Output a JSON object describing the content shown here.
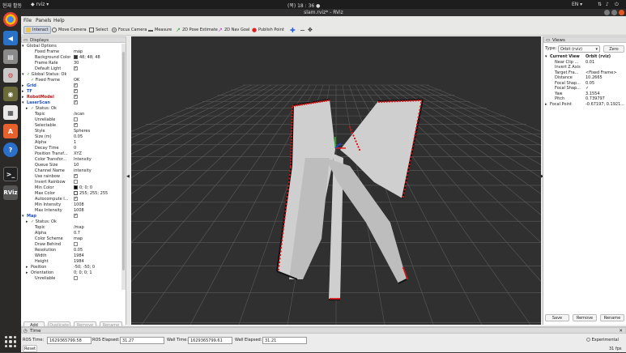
{
  "topbar": {
    "activities": "현재 활동",
    "app": "rviz",
    "clock": "(목) 18 : 36 ●",
    "lang": "EN ▾"
  },
  "window": {
    "title": "slam.rviz* - RViz"
  },
  "menu": [
    "File",
    "Panels",
    "Help"
  ],
  "toolbar": [
    {
      "label": "Interact",
      "icon": "interact-icon",
      "active": true
    },
    {
      "label": "Move Camera",
      "icon": "move-camera-icon"
    },
    {
      "label": "Select",
      "icon": "select-icon"
    },
    {
      "label": "Focus Camera",
      "icon": "focus-camera-icon"
    },
    {
      "label": "Measure",
      "icon": "measure-icon"
    },
    {
      "label": "2D Pose Estimate",
      "icon": "pose-estimate-icon"
    },
    {
      "label": "2D Nav Goal",
      "icon": "nav-goal-icon"
    },
    {
      "label": "Publish Point",
      "icon": "publish-point-icon"
    }
  ],
  "displays": {
    "title": "Displays",
    "rows": [
      {
        "k": "Global Options",
        "ind": 1,
        "exp": "▾",
        "icon": "globe"
      },
      {
        "k": "Fixed Frame",
        "v": "map",
        "ind": 3
      },
      {
        "k": "Background Color",
        "v": "48; 48; 48",
        "ind": 3,
        "sw": "#303030"
      },
      {
        "k": "Frame Rate",
        "v": "30",
        "ind": 3
      },
      {
        "k": "Default Light",
        "v": "",
        "ind": 3,
        "chk": true
      },
      {
        "k": "Global Status: Ok",
        "ind": 1,
        "exp": "▾",
        "ok": true
      },
      {
        "k": "Fixed Frame",
        "v": "OK",
        "ind": 2,
        "ok": true
      },
      {
        "k": "Grid",
        "ind": 1,
        "exp": "▸",
        "blue": true,
        "chk": true
      },
      {
        "k": "TF",
        "ind": 1,
        "exp": "▸",
        "blue": true,
        "chk": true
      },
      {
        "k": "RobotModel",
        "ind": 1,
        "exp": "▸",
        "red": true,
        "chk": true
      },
      {
        "k": "LaserScan",
        "ind": 1,
        "exp": "▾",
        "blue": true,
        "chk": true
      },
      {
        "k": "Status: Ok",
        "ind": 2,
        "exp": "▸",
        "ok": true
      },
      {
        "k": "Topic",
        "v": "/scan",
        "ind": 3
      },
      {
        "k": "Unreliable",
        "v": "",
        "ind": 3,
        "chk": false
      },
      {
        "k": "Selectable",
        "v": "",
        "ind": 3,
        "chk": true
      },
      {
        "k": "Style",
        "v": "Spheres",
        "ind": 3
      },
      {
        "k": "Size (m)",
        "v": "0.05",
        "ind": 3
      },
      {
        "k": "Alpha",
        "v": "1",
        "ind": 3
      },
      {
        "k": "Decay Time",
        "v": "0",
        "ind": 3
      },
      {
        "k": "Position Transf...",
        "v": "XYZ",
        "ind": 3
      },
      {
        "k": "Color Transfor...",
        "v": "Intensity",
        "ind": 3
      },
      {
        "k": "Queue Size",
        "v": "10",
        "ind": 3
      },
      {
        "k": "Channel Name",
        "v": "intensity",
        "ind": 3
      },
      {
        "k": "Use rainbow",
        "v": "",
        "ind": 3,
        "chk": true
      },
      {
        "k": "Invert Rainbow",
        "v": "",
        "ind": 3,
        "chk": false
      },
      {
        "k": "Min Color",
        "v": "0; 0; 0",
        "ind": 3,
        "sw": "#000000"
      },
      {
        "k": "Max Color",
        "v": "255; 255; 255",
        "ind": 3,
        "sw": "#ffffff"
      },
      {
        "k": "Autocompute I...",
        "v": "",
        "ind": 3,
        "chk": true
      },
      {
        "k": "Min Intensity",
        "v": "1008",
        "ind": 3
      },
      {
        "k": "Max Intensity",
        "v": "1008",
        "ind": 3
      },
      {
        "k": "Map",
        "ind": 1,
        "exp": "▾",
        "blue": true,
        "chk": true
      },
      {
        "k": "Status: Ok",
        "ind": 2,
        "exp": "▸",
        "ok": true
      },
      {
        "k": "Topic",
        "v": "/map",
        "ind": 3
      },
      {
        "k": "Alpha",
        "v": "0.7",
        "ind": 3
      },
      {
        "k": "Color Scheme",
        "v": "map",
        "ind": 3
      },
      {
        "k": "Draw Behind",
        "v": "",
        "ind": 3,
        "chk": false
      },
      {
        "k": "Resolution",
        "v": "0.05",
        "ind": 3
      },
      {
        "k": "Width",
        "v": "1984",
        "ind": 3
      },
      {
        "k": "Height",
        "v": "1984",
        "ind": 3
      },
      {
        "k": "Position",
        "v": "-50; -50; 0",
        "ind": 2,
        "exp": "▸"
      },
      {
        "k": "Orientation",
        "v": "0; 0; 0; 1",
        "ind": 2,
        "exp": "▸"
      },
      {
        "k": "Unreliable",
        "v": "",
        "ind": 3,
        "chk": false
      }
    ],
    "buttons": {
      "add": "Add",
      "duplicate": "Duplicate",
      "remove": "Remove",
      "rename": "Rename"
    }
  },
  "views": {
    "title": "Views",
    "type_label": "Type:",
    "type_value": "Orbit (rviz)",
    "zero": "Zero",
    "rows": [
      {
        "k": "Current View",
        "v": "Orbit (rviz)",
        "bold": true,
        "ind": 1,
        "exp": "▾"
      },
      {
        "k": "Near Clip ...",
        "v": "0.01",
        "ind": 2
      },
      {
        "k": "Invert Z Axis",
        "v": "",
        "ind": 2
      },
      {
        "k": "Target Fra...",
        "v": "<Fixed Frame>",
        "ind": 2
      },
      {
        "k": "Distance",
        "v": "10.2665",
        "ind": 2
      },
      {
        "k": "Focal Shap...",
        "v": "0.05",
        "ind": 2
      },
      {
        "k": "Focal Shap...",
        "v": "✓",
        "ind": 2
      },
      {
        "k": "Yaw",
        "v": "3.1554",
        "ind": 2
      },
      {
        "k": "Pitch",
        "v": "0.739797",
        "ind": 2
      },
      {
        "k": "Focal Point",
        "v": "-0.67197; 0.1921...",
        "ind": 1,
        "exp": "▸"
      }
    ],
    "buttons": {
      "save": "Save",
      "remove": "Remove",
      "rename": "Rename"
    }
  },
  "time": {
    "title": "Time",
    "ros_time_label": "ROS Time:",
    "ros_time": "1629365799.58",
    "ros_elapsed_label": "ROS Elapsed:",
    "ros_elapsed": "31.27",
    "wall_time_label": "Wall Time:",
    "wall_time": "1629365799.61",
    "wall_elapsed_label": "Wall Elapsed:",
    "wall_elapsed": "31.21",
    "experimental": "Experimental",
    "reset": "Reset",
    "fps": "31 fps"
  },
  "colors": {
    "accent": "#1f4fbf",
    "background": "#303030",
    "laser": "#e01010"
  }
}
